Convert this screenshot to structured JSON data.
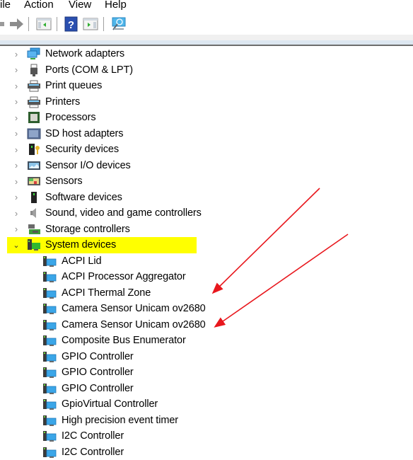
{
  "menubar": {
    "items": [
      "ile",
      "Action",
      "View",
      "Help"
    ]
  },
  "toolbar": {
    "buttons": [
      {
        "name": "back-icon"
      },
      {
        "name": "forward-icon"
      },
      {
        "name": "show-hide-console-tree-icon"
      },
      {
        "name": "help-icon"
      },
      {
        "name": "show-hide-action-pane-icon"
      },
      {
        "name": "scan-hardware-changes-icon"
      }
    ]
  },
  "tree": {
    "categories": [
      {
        "label": "Network adapters",
        "icon": "network-adapter-icon",
        "expanded": false
      },
      {
        "label": "Ports (COM & LPT)",
        "icon": "port-icon",
        "expanded": false
      },
      {
        "label": "Print queues",
        "icon": "printer-icon",
        "expanded": false
      },
      {
        "label": "Printers",
        "icon": "printer-icon",
        "expanded": false
      },
      {
        "label": "Processors",
        "icon": "processor-icon",
        "expanded": false
      },
      {
        "label": "SD host adapters",
        "icon": "sd-card-icon",
        "expanded": false
      },
      {
        "label": "Security devices",
        "icon": "security-device-icon",
        "expanded": false
      },
      {
        "label": "Sensor I/O devices",
        "icon": "sensor-io-icon",
        "expanded": false
      },
      {
        "label": "Sensors",
        "icon": "sensor-icon",
        "expanded": false
      },
      {
        "label": "Software devices",
        "icon": "software-device-icon",
        "expanded": false
      },
      {
        "label": "Sound, video and game controllers",
        "icon": "speaker-icon",
        "expanded": false
      },
      {
        "label": "Storage controllers",
        "icon": "storage-controller-icon",
        "expanded": false
      },
      {
        "label": "System devices",
        "icon": "system-device-icon",
        "expanded": true,
        "highlighted": true,
        "highlight_color": "#ffff00"
      }
    ],
    "system_devices": [
      "ACPI Lid",
      "ACPI Processor Aggregator",
      "ACPI Thermal Zone",
      "Camera Sensor Unicam ov2680",
      "Camera Sensor Unicam ov2680",
      "Composite Bus Enumerator",
      "GPIO Controller",
      "GPIO Controller",
      "GPIO Controller",
      "GpioVirtual Controller",
      "High precision event timer",
      "I2C Controller",
      "I2C Controller"
    ]
  },
  "annotations": {
    "arrow_color": "#e8171d",
    "arrows_point_to": [
      "Camera Sensor Unicam ov2680",
      "Camera Sensor Unicam ov2680"
    ]
  }
}
